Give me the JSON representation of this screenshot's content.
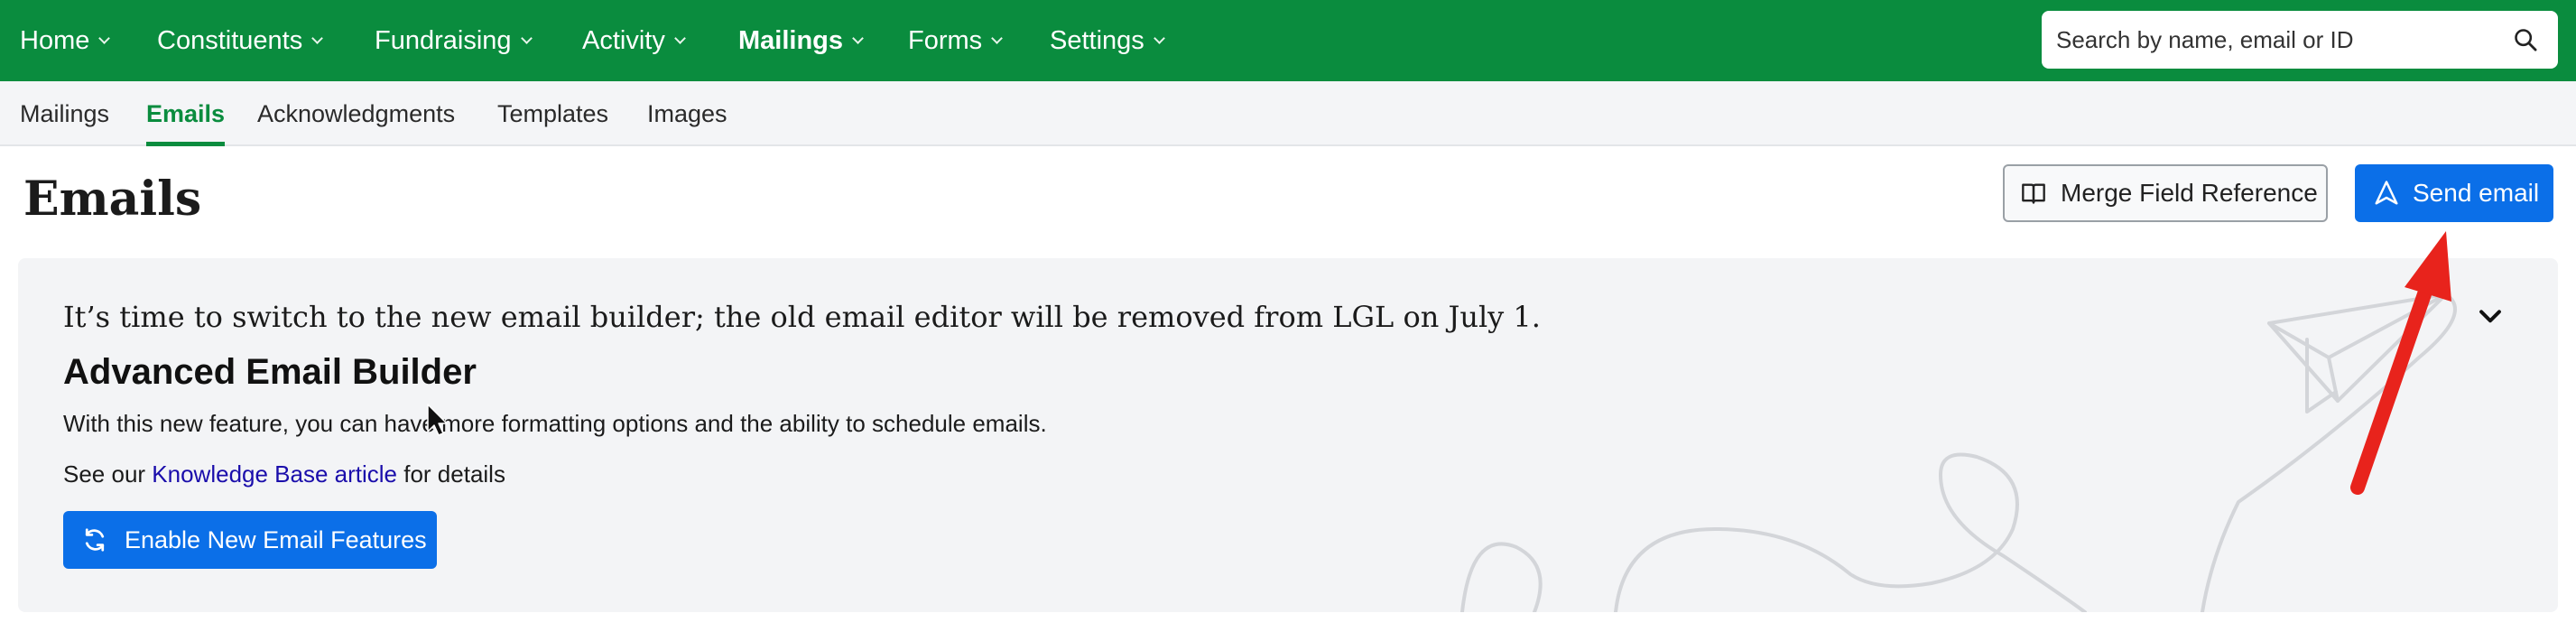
{
  "nav": {
    "items": [
      {
        "label": "Home"
      },
      {
        "label": "Constituents"
      },
      {
        "label": "Fundraising"
      },
      {
        "label": "Activity"
      },
      {
        "label": "Mailings"
      },
      {
        "label": "Forms"
      },
      {
        "label": "Settings"
      }
    ],
    "active": "Mailings",
    "search_placeholder": "Search by name, email or ID",
    "search_icon": "search-icon"
  },
  "subnav": {
    "items": [
      {
        "label": "Mailings"
      },
      {
        "label": "Emails"
      },
      {
        "label": "Acknowledgments"
      },
      {
        "label": "Templates"
      },
      {
        "label": "Images"
      }
    ],
    "active": "Emails"
  },
  "header": {
    "title": "Emails",
    "merge_field_label": "Merge Field Reference",
    "merge_field_icon": "book-icon",
    "send_email_label": "Send email",
    "send_email_icon": "send-icon"
  },
  "banner": {
    "notice": "It’s time to switch to the new email builder; the old email editor will be removed from LGL on July 1.",
    "heading": "Advanced Email Builder",
    "description": "With this new feature, you can have more formatting options and the ability to schedule emails.",
    "kb_prefix": "See our ",
    "kb_link": "Knowledge Base article",
    "kb_suffix": " for details",
    "enable_label": "Enable New Email Features",
    "enable_icon": "refresh-icon",
    "collapse_icon": "chevron-down-icon"
  },
  "colors": {
    "nav_green": "#0a8c3e",
    "primary_blue": "#0b6fe8",
    "panel_bg": "#f3f4f6",
    "annotation_red": "#e8231c"
  }
}
